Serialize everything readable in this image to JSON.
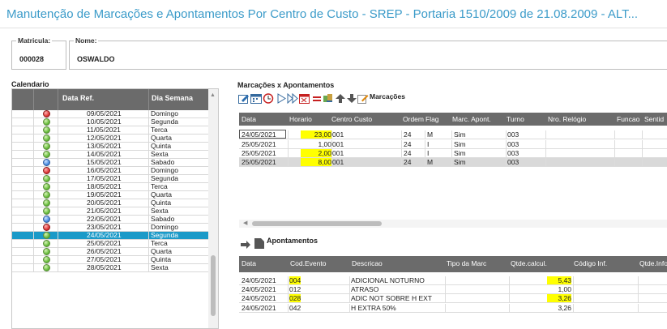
{
  "title": "Manutenção de Marcações e Apontamentos Por Centro de Custo - SREP - Portaria 1510/2009 de 21.08.2009 - ALT...",
  "fields": {
    "matricula_label": "Matricula:",
    "matricula_value": "000028",
    "nome_label": "Nome:",
    "nome_value": "OSWALDO"
  },
  "calendar": {
    "label": "Calendario",
    "headers": [
      "Data Ref.",
      "Dia Semana"
    ],
    "rows": [
      {
        "date": "09/05/2021",
        "day": "Domingo",
        "status": "red"
      },
      {
        "date": "10/05/2021",
        "day": "Segunda",
        "status": "green"
      },
      {
        "date": "11/05/2021",
        "day": "Terca",
        "status": "green"
      },
      {
        "date": "12/05/2021",
        "day": "Quarta",
        "status": "green"
      },
      {
        "date": "13/05/2021",
        "day": "Quinta",
        "status": "green"
      },
      {
        "date": "14/05/2021",
        "day": "Sexta",
        "status": "green"
      },
      {
        "date": "15/05/2021",
        "day": "Sabado",
        "status": "blue"
      },
      {
        "date": "16/05/2021",
        "day": "Domingo",
        "status": "red"
      },
      {
        "date": "17/05/2021",
        "day": "Segunda",
        "status": "green"
      },
      {
        "date": "18/05/2021",
        "day": "Terca",
        "status": "green"
      },
      {
        "date": "19/05/2021",
        "day": "Quarta",
        "status": "green"
      },
      {
        "date": "20/05/2021",
        "day": "Quinta",
        "status": "green"
      },
      {
        "date": "21/05/2021",
        "day": "Sexta",
        "status": "green"
      },
      {
        "date": "22/05/2021",
        "day": "Sabado",
        "status": "blue"
      },
      {
        "date": "23/05/2021",
        "day": "Domingo",
        "status": "red"
      },
      {
        "date": "24/05/2021",
        "day": "Segunda",
        "status": "green",
        "selected": true
      },
      {
        "date": "25/05/2021",
        "day": "Terca",
        "status": "green"
      },
      {
        "date": "26/05/2021",
        "day": "Quarta",
        "status": "green"
      },
      {
        "date": "27/05/2021",
        "day": "Quinta",
        "status": "green"
      },
      {
        "date": "28/05/2021",
        "day": "Sexta",
        "status": "green"
      }
    ]
  },
  "marcacoes": {
    "section_label": "Marcações x Apontamentos",
    "toolbar_label": "Marcações",
    "headers": [
      "Data",
      "Horario",
      "Centro Custo",
      "Ordem",
      "Flag",
      "Marc. Apont.",
      "Turno",
      "Nro. Relógio",
      "Funcao",
      "Sentid"
    ],
    "rows": [
      {
        "data": "24/05/2021",
        "horario": "23,00",
        "cc": "001",
        "ordem": "24",
        "flag": "M",
        "apont": "Sim",
        "turno": "003",
        "hl": true
      },
      {
        "data": "25/05/2021",
        "horario": "1,00",
        "cc": "001",
        "ordem": "24",
        "flag": "I",
        "apont": "Sim",
        "turno": "003",
        "hl": false
      },
      {
        "data": "25/05/2021",
        "horario": "2,00",
        "cc": "001",
        "ordem": "24",
        "flag": "I",
        "apont": "Sim",
        "turno": "003",
        "hl": true
      },
      {
        "data": "25/05/2021",
        "horario": "8,00",
        "cc": "001",
        "ordem": "24",
        "flag": "M",
        "apont": "Sim",
        "turno": "003",
        "hl": true
      }
    ]
  },
  "apontamentos": {
    "label": "Apontamentos",
    "headers": [
      "Data",
      "Cod.Evento",
      "Descricao",
      "Tipo da Marc",
      "Qtde.calcul.",
      "Código Inf.",
      "Qtde.Info"
    ],
    "rows": [
      {
        "data": "24/05/2021",
        "cod": "004",
        "desc": "ADICIONAL NOTURNO",
        "qtd": "5,43",
        "hl": true
      },
      {
        "data": "24/05/2021",
        "cod": "012",
        "desc": "ATRASO",
        "qtd": "1,00",
        "hl": false
      },
      {
        "data": "24/05/2021",
        "cod": "028",
        "desc": "ADIC NOT SOBRE H EXT",
        "qtd": "3,26",
        "hl": true
      },
      {
        "data": "24/05/2021",
        "cod": "042",
        "desc": "H EXTRA 50%",
        "qtd": "3,26",
        "hl": false
      }
    ]
  },
  "colors": {
    "title": "#3b9bc9",
    "header_bg": "#6b6b6b",
    "selected_row": "#1b9ac8",
    "highlight": "#ffff00"
  }
}
